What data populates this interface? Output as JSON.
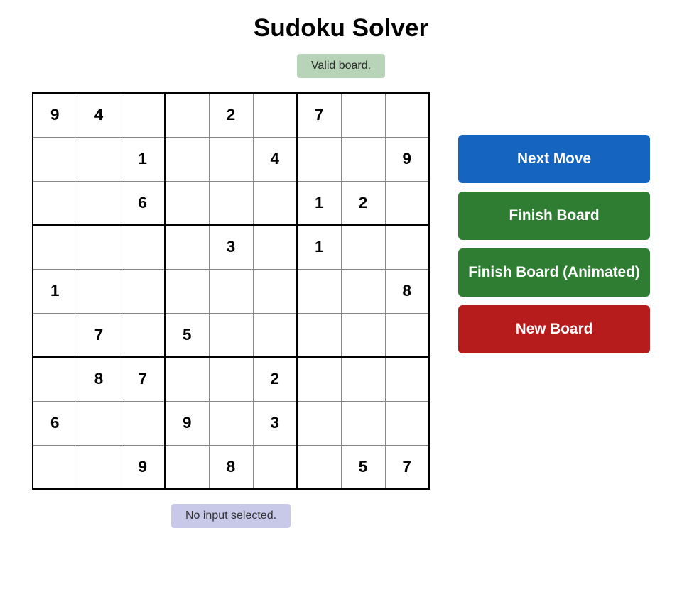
{
  "page": {
    "title": "Sudoku Solver",
    "status": "Valid board.",
    "no_input": "No input selected."
  },
  "buttons": {
    "next_move": "Next Move",
    "finish_board": "Finish Board",
    "finish_board_animated": "Finish Board (Animated)",
    "new_board": "New Board"
  },
  "board": {
    "cells": [
      [
        "9",
        "4",
        "",
        "",
        "2",
        "",
        "7",
        "",
        ""
      ],
      [
        "",
        "",
        "1",
        "",
        "",
        "4",
        "",
        "",
        "9"
      ],
      [
        "",
        "",
        "6",
        "",
        "",
        "",
        "1",
        "2",
        ""
      ],
      [
        "",
        "",
        "",
        "",
        "3",
        "",
        "1",
        "",
        ""
      ],
      [
        "1",
        "",
        "",
        "",
        "",
        "",
        "",
        "",
        "8"
      ],
      [
        "",
        "7",
        "",
        "5",
        "",
        "",
        "",
        "",
        ""
      ],
      [
        "",
        "8",
        "7",
        "",
        "",
        "2",
        "",
        "",
        ""
      ],
      [
        "6",
        "",
        "",
        "9",
        "",
        "3",
        "",
        "",
        ""
      ],
      [
        "",
        "",
        "9",
        "",
        "8",
        "",
        "",
        "5",
        "7"
      ]
    ]
  }
}
